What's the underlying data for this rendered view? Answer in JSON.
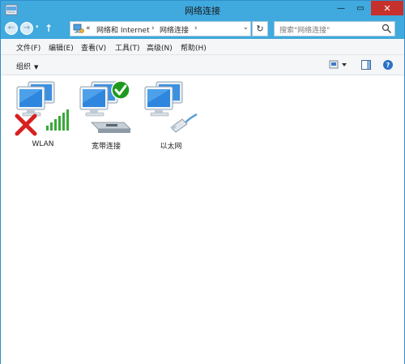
{
  "window": {
    "title": "网络连接",
    "close_glyph": "✕",
    "minimize_glyph": "—",
    "maximize_glyph": "▭"
  },
  "nav": {
    "back_glyph": "←",
    "forward_glyph": "→",
    "dropdown_glyph": "▾",
    "up_glyph": "↑"
  },
  "address": {
    "overflow": "«",
    "segments": [
      "网络和 Internet",
      "网络连接"
    ],
    "separator": "›",
    "dropdown_glyph": "⌄",
    "refresh_glyph": "↻"
  },
  "search": {
    "placeholder": "搜索\"网络连接\""
  },
  "menu": [
    "文件(F)",
    "编辑(E)",
    "查看(V)",
    "工具(T)",
    "高级(N)",
    "帮助(H)"
  ],
  "toolbar": {
    "organize": "组织",
    "organize_arrow": "▼",
    "help_glyph": "?"
  },
  "connections": [
    {
      "name": "WLAN",
      "status": "disconnected",
      "type": "wireless"
    },
    {
      "name": "宽带连接",
      "status": "connected",
      "type": "broadband"
    },
    {
      "name": "以太网",
      "status": "normal",
      "type": "ethernet"
    }
  ],
  "colors": {
    "frame": "#40a9de",
    "close": "#c7312c",
    "connected": "#1f9a1f",
    "disconnected": "#d92020",
    "signal": "#3aa83a"
  },
  "icons": {
    "back": "back-arrow-icon",
    "forward": "forward-arrow-icon",
    "up": "up-arrow-icon",
    "search": "search-icon",
    "refresh": "refresh-icon",
    "help": "help-icon"
  }
}
